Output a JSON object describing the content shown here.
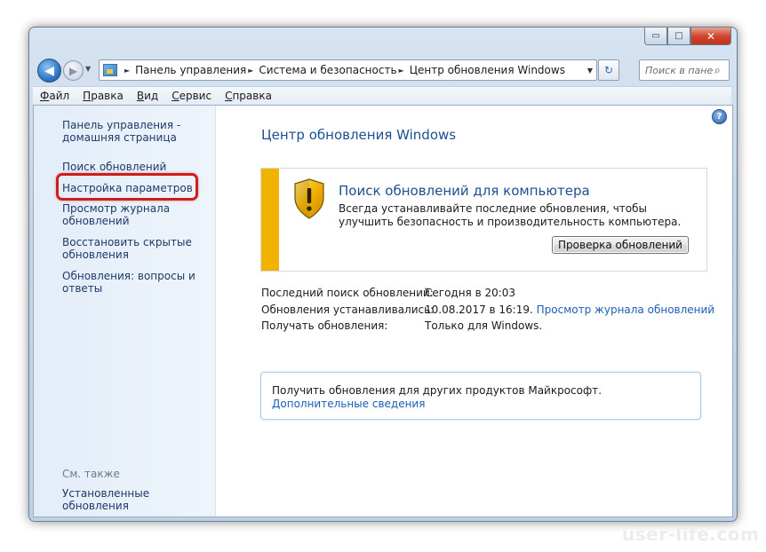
{
  "window": {
    "caption": {
      "minimize": "▭",
      "maximize": "□",
      "close": "✕"
    }
  },
  "nav": {
    "back": "◀",
    "forward": "▶",
    "history": "▼"
  },
  "address": {
    "breadcrumbs": [
      "Панель управления",
      "Система и безопасность",
      "Центр обновления Windows"
    ],
    "separator": "►",
    "dropdown": "▼",
    "refresh": "↻"
  },
  "search": {
    "placeholder": "Поиск в панели управления",
    "icon": "search-icon"
  },
  "menu": [
    {
      "key": "Ф",
      "rest": "айл"
    },
    {
      "key": "П",
      "rest": "равка"
    },
    {
      "key": "В",
      "rest": "ид"
    },
    {
      "key": "С",
      "rest": "ервис"
    },
    {
      "key": "С",
      "rest": "правка"
    }
  ],
  "sidebar": {
    "home_link": "Панель управления - домашняя страница",
    "links": [
      "Поиск обновлений",
      "Настройка параметров",
      "Просмотр журнала обновлений",
      "Восстановить скрытые обновления",
      "Обновления: вопросы и ответы"
    ],
    "see_also_label": "См. также",
    "see_also_link": "Установленные обновления"
  },
  "main": {
    "help": "?",
    "title": "Центр обновления Windows",
    "status": {
      "title": "Поиск обновлений для компьютера",
      "text": "Всегда устанавливайте последние обновления, чтобы улучшить безопасность и производительность компьютера.",
      "button": "Проверка обновлений",
      "stripe_color": "#f1b300"
    },
    "info": [
      {
        "label": "Последний поиск обновлений:",
        "value": "Сегодня в 20:03"
      },
      {
        "label": "Обновления устанавливались:",
        "value": "10.08.2017 в 16:19.",
        "link": "Просмотр журнала обновлений"
      },
      {
        "label": "Получать обновления:",
        "value": "Только для Windows."
      }
    ],
    "notice": {
      "text": "Получить обновления для других продуктов Майкрософт.",
      "link": "Дополнительные сведения"
    }
  },
  "watermark": "user-life.com"
}
